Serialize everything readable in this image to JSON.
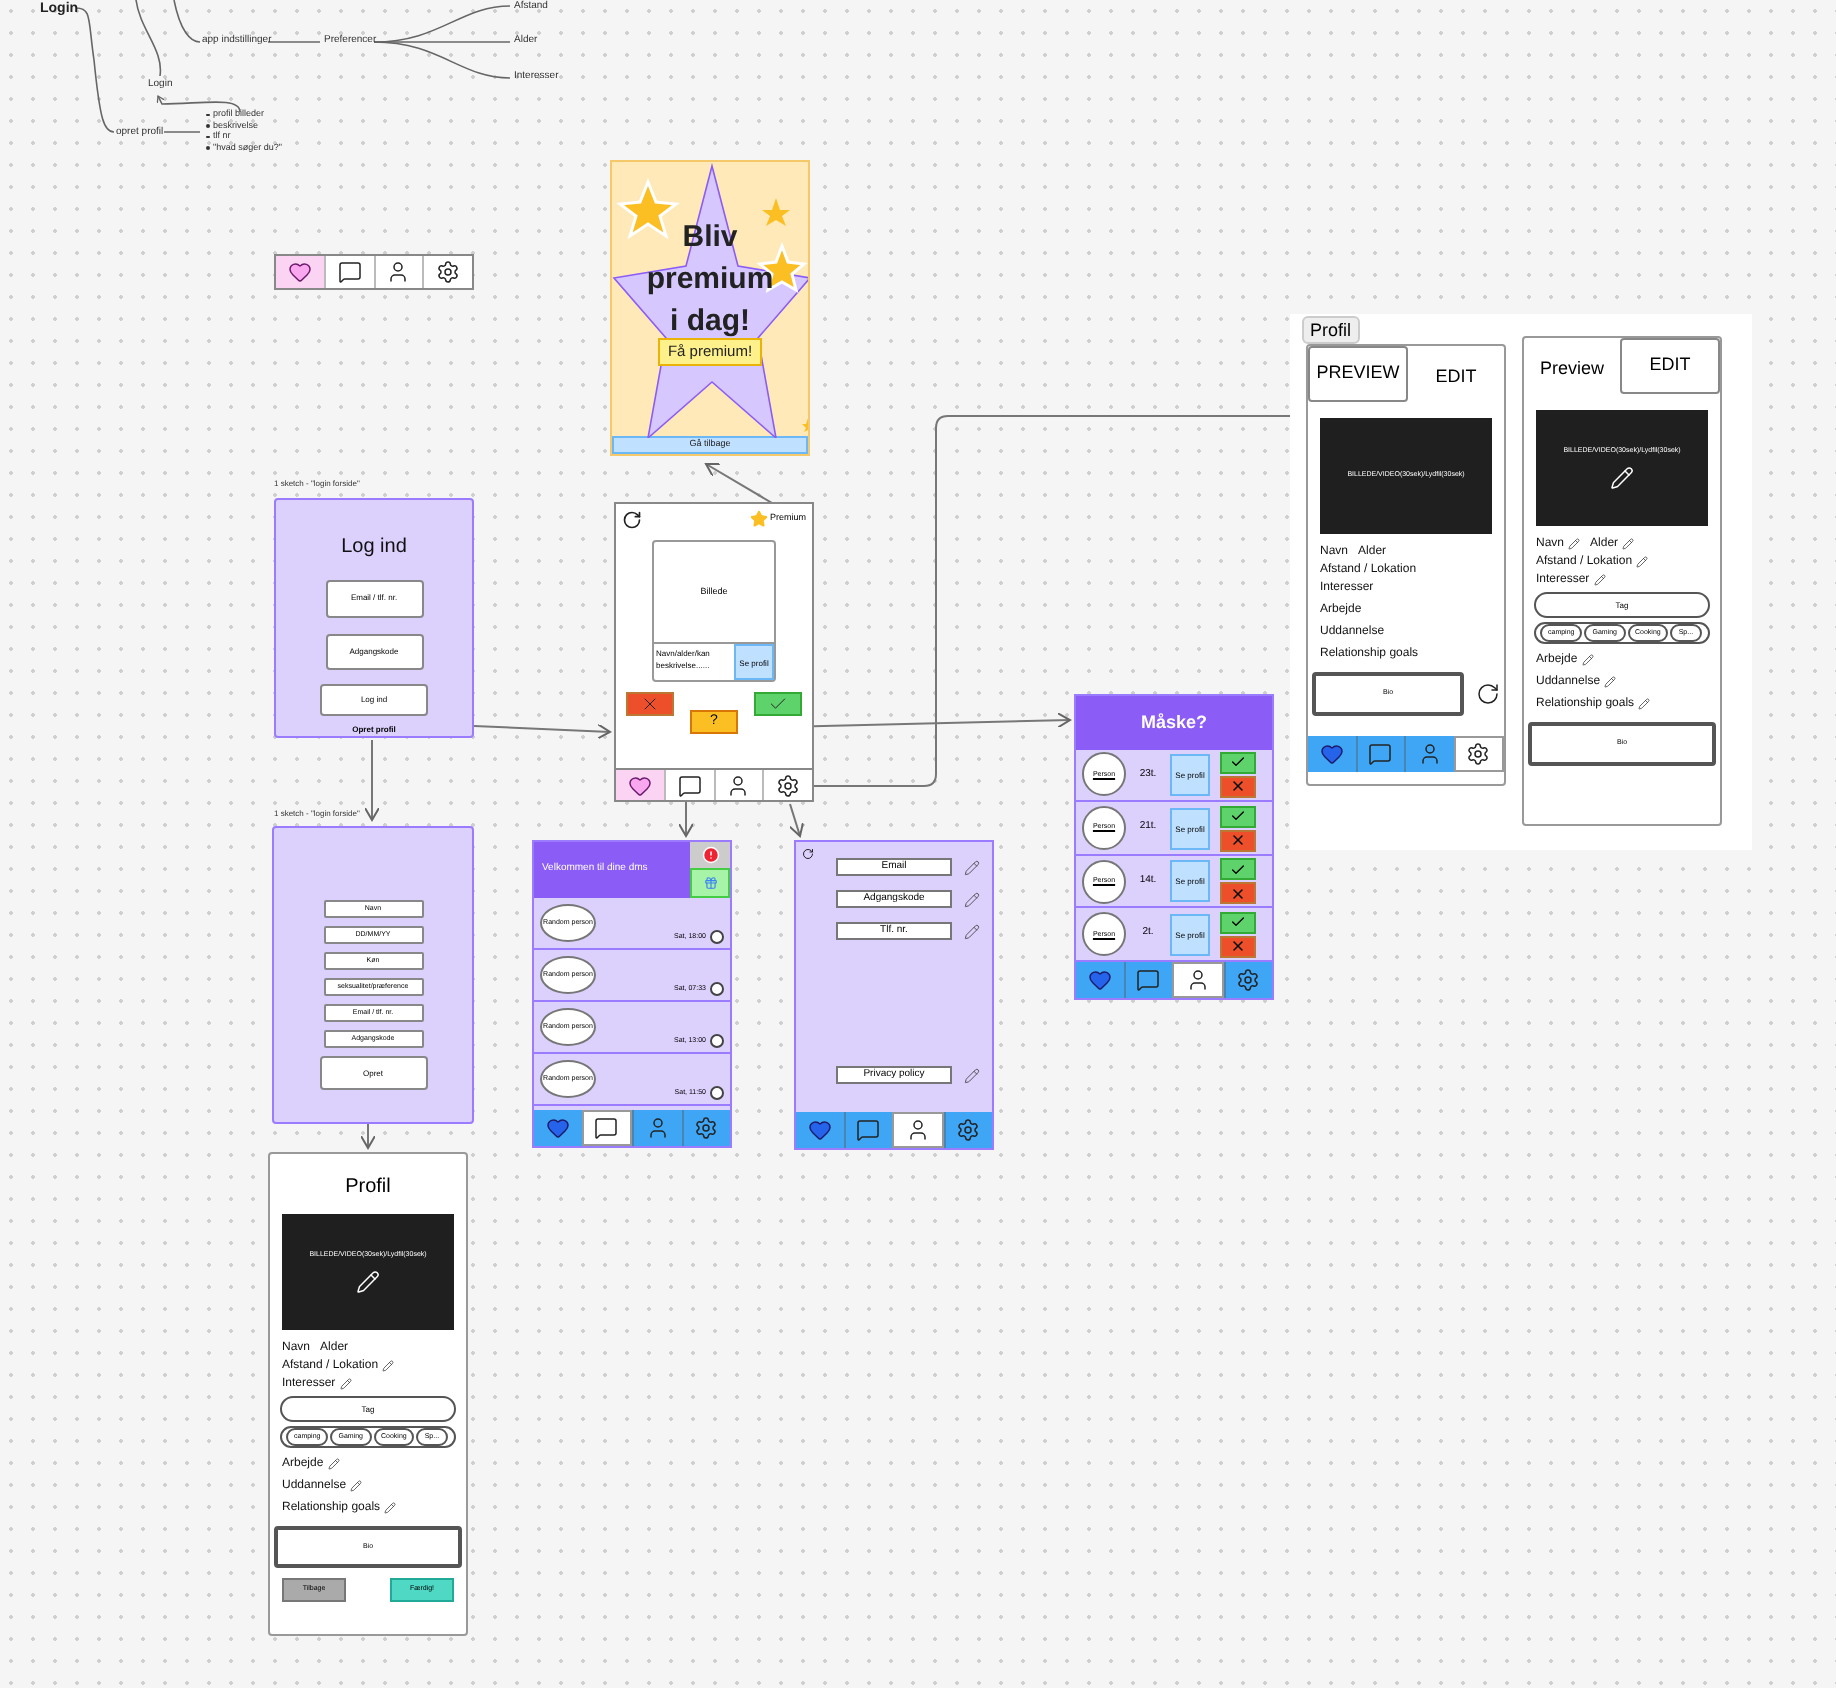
{
  "mind_map": {
    "root": "Login",
    "branches": [
      {
        "label": "app indstillinger",
        "children": [
          {
            "label": "Preferencer",
            "children": [
              {
                "label": "Afstand"
              },
              {
                "label": "Alder"
              },
              {
                "label": "Interesser"
              }
            ]
          }
        ]
      },
      {
        "label": "Login"
      },
      {
        "label": "opret profil",
        "notes": [
          "profil billeder",
          "beskrivelse",
          "tlf nr",
          "\"hvad søger du?\""
        ]
      }
    ]
  },
  "nav_component": {
    "kind": "plain",
    "tabs": [
      {
        "kind": "heart",
        "selected": true
      },
      {
        "kind": "chat",
        "selected": false
      },
      {
        "kind": "person",
        "selected": false
      },
      {
        "kind": "settings",
        "selected": false
      }
    ]
  },
  "login_frame": {
    "caption": "1 sketch - \"login forside\"",
    "title": "Log ind",
    "fields": [
      "Email / tlf. nr.",
      "Adgangskode"
    ],
    "button": "Log ind",
    "link": "Opret profil"
  },
  "signup_frame": {
    "caption": "1 sketch - \"login forside\"",
    "fields": [
      "Navn",
      "DD/MM/YY",
      "Køn",
      "seksualitet/præference",
      "Email / tlf. nr.",
      "Adgangskode"
    ],
    "button": "Opret"
  },
  "profile_frame": {
    "title": "Profil",
    "media": {
      "text": "BILLEDE/VIDEO(30sek)/Lydfil(30sek)",
      "editable": true
    },
    "upper_lines": [
      {
        "items": [
          {
            "label": "Navn",
            "editable": false
          },
          {
            "label": "Alder",
            "editable": false
          }
        ]
      },
      {
        "items": [
          {
            "label": "Afstand / Lokation",
            "editable": true
          }
        ]
      },
      {
        "items": [
          {
            "label": "Interesser",
            "editable": true
          }
        ]
      }
    ],
    "tag_field": "Tag",
    "tags": [
      "camping",
      "Gaming",
      "Cooking",
      "Sp..."
    ],
    "lower_lines": [
      {
        "items": [
          {
            "label": "Arbejde",
            "editable": true
          }
        ]
      },
      {
        "items": [
          {
            "label": "Uddannelse",
            "editable": true
          }
        ]
      },
      {
        "items": [
          {
            "label": "Relationship goals",
            "editable": true
          }
        ]
      }
    ],
    "bio": "Bio",
    "buttons": [
      {
        "label": "Tilbage",
        "kind": "back"
      },
      {
        "label": "Færdig!",
        "kind": "done"
      }
    ]
  },
  "premium_frame": {
    "title": "Bliv premium i dag!",
    "button": "Få premium!",
    "back": "Gå tilbage"
  },
  "swipe_frame": {
    "badge": "Premium",
    "photo": "Billede",
    "description": "Navn/alder/kan beskrivelse......",
    "profile_button": "Se profil",
    "actions": [
      {
        "kind": "reject"
      },
      {
        "kind": "maybe",
        "label": "?"
      },
      {
        "kind": "accept"
      }
    ],
    "nav": {
      "kind": "plain",
      "tabs": [
        {
          "kind": "heart",
          "selected": true
        },
        {
          "kind": "chat",
          "selected": false
        },
        {
          "kind": "person",
          "selected": false
        },
        {
          "kind": "settings",
          "selected": false
        }
      ]
    }
  },
  "dms_frame": {
    "title": "Velkommen til dine dms",
    "chats": [
      {
        "name": "Random person",
        "time": "Sat, 18:00"
      },
      {
        "name": "Random person",
        "time": "Sat, 07:33"
      },
      {
        "name": "Random person",
        "time": "Sat, 13:00"
      },
      {
        "name": "Random person",
        "time": "Sat, 11:50"
      }
    ],
    "nav": {
      "kind": "blue",
      "tabs": [
        {
          "kind": "heart",
          "selected": false
        },
        {
          "kind": "chat",
          "selected": true
        },
        {
          "kind": "person",
          "selected": false
        },
        {
          "kind": "settings",
          "selected": false
        }
      ]
    }
  },
  "settings_frame": {
    "fields": [
      "Email",
      "Adgangskode",
      "Tlf. nr."
    ],
    "footer_field": "Privacy policy",
    "nav": {
      "kind": "blue",
      "tabs": [
        {
          "kind": "heart",
          "selected": false
        },
        {
          "kind": "chat",
          "selected": false
        },
        {
          "kind": "person",
          "selected": true
        },
        {
          "kind": "settings",
          "selected": false
        }
      ]
    }
  },
  "maybe_frame": {
    "title": "Måske?",
    "people": [
      {
        "name": "Person",
        "time": "23t.",
        "button": "Se profil"
      },
      {
        "name": "Person",
        "time": "21t.",
        "button": "Se profil"
      },
      {
        "name": "Person",
        "time": "14t.",
        "button": "Se profil"
      },
      {
        "name": "Person",
        "time": "2t.",
        "button": "Se profil"
      }
    ],
    "nav": {
      "kind": "blue",
      "tabs": [
        {
          "kind": "heart",
          "selected": false
        },
        {
          "kind": "chat",
          "selected": false
        },
        {
          "kind": "person",
          "selected": true
        },
        {
          "kind": "settings",
          "selected": false
        }
      ]
    }
  },
  "profile_panel": {
    "label": "Profil",
    "preview": {
      "tabs": [
        {
          "label": "PREVIEW",
          "selected": true
        },
        {
          "label": "EDIT",
          "selected": false
        }
      ],
      "media": {
        "text": "BILLEDE/VIDEO(30sek)/Lydfil(30sek)",
        "editable": false
      },
      "upper_lines": [
        {
          "items": [
            {
              "label": "Navn",
              "editable": false
            },
            {
              "label": "Alder",
              "editable": false
            }
          ]
        },
        {
          "items": [
            {
              "label": "Afstand / Lokation",
              "editable": false
            }
          ]
        },
        {
          "items": [
            {
              "label": "Interesser",
              "editable": false
            }
          ]
        }
      ],
      "lower_lines": [
        {
          "items": [
            {
              "label": "Arbejde",
              "editable": false
            }
          ]
        },
        {
          "items": [
            {
              "label": "Uddannelse",
              "editable": false
            }
          ]
        },
        {
          "items": [
            {
              "label": "Relationship goals",
              "editable": false
            }
          ]
        }
      ],
      "bio": "Bio",
      "refresh": true,
      "nav": {
        "kind": "blue",
        "tabs": [
          {
            "kind": "heart",
            "selected": false
          },
          {
            "kind": "chat",
            "selected": false
          },
          {
            "kind": "person",
            "selected": false
          },
          {
            "kind": "settings",
            "selected": true
          }
        ]
      }
    },
    "edit": {
      "tabs": [
        {
          "label": "Preview",
          "selected": false
        },
        {
          "label": "EDIT",
          "selected": true
        }
      ],
      "media": {
        "text": "BILLEDE/VIDEO(30sek)/Lydfil(30sek)",
        "editable": true
      },
      "upper_lines": [
        {
          "items": [
            {
              "label": "Navn",
              "editable": true
            },
            {
              "label": "Alder",
              "editable": true
            }
          ]
        },
        {
          "items": [
            {
              "label": "Afstand / Lokation",
              "editable": true
            }
          ]
        },
        {
          "items": [
            {
              "label": "Interesser",
              "editable": true
            }
          ]
        }
      ],
      "tag_field": "Tag",
      "tags": [
        "camping",
        "Gaming",
        "Cooking",
        "Sp..."
      ],
      "lower_lines": [
        {
          "items": [
            {
              "label": "Arbejde",
              "editable": true
            }
          ]
        },
        {
          "items": [
            {
              "label": "Uddannelse",
              "editable": true
            }
          ]
        },
        {
          "items": [
            {
              "label": "Relationship goals",
              "editable": true
            }
          ]
        }
      ],
      "bio": "Bio"
    }
  }
}
